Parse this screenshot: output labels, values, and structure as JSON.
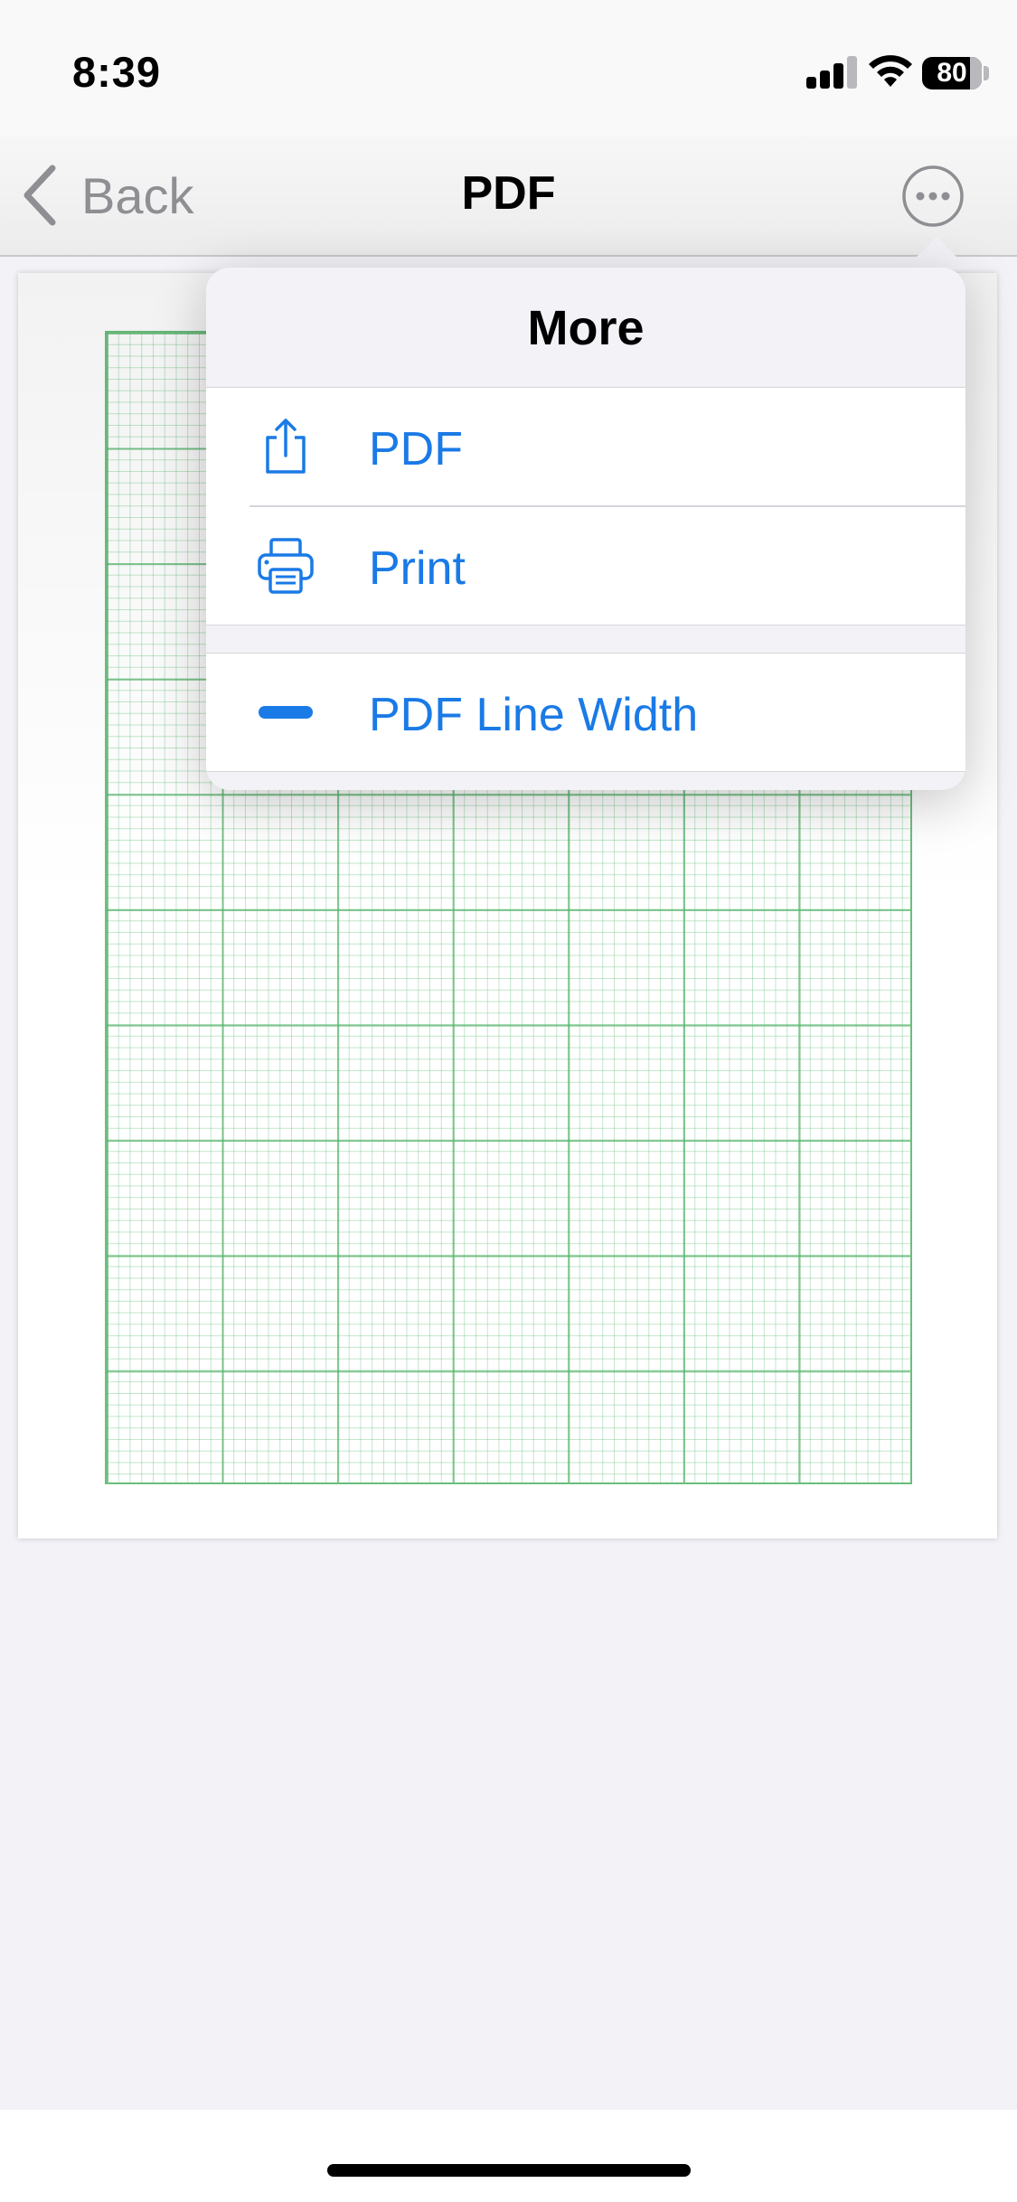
{
  "status_bar": {
    "time": "8:39",
    "battery_level": "80",
    "battery_fraction": 0.8,
    "signal_bars": 3
  },
  "nav": {
    "back_label": "Back",
    "title": "PDF"
  },
  "popover": {
    "title": "More",
    "items": [
      {
        "label": "PDF",
        "icon": "share-icon"
      },
      {
        "label": "Print",
        "icon": "printer-icon"
      },
      {
        "label": "PDF Line Width",
        "icon": "line-width-icon"
      }
    ]
  },
  "colors": {
    "accent": "#1a7ae6",
    "grid": "#58b46e",
    "secondary_text": "#8e8e93",
    "background": "#f2f2f7"
  }
}
